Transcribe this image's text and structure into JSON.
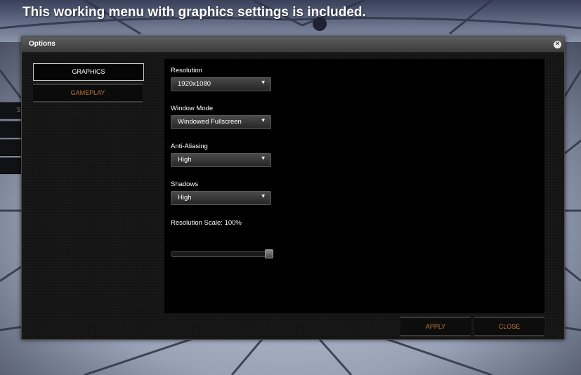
{
  "caption": "This working menu with graphics settings is included.",
  "window": {
    "title": "Options",
    "close_glyph": "✕"
  },
  "tabs": [
    {
      "label": "GRAPHICS",
      "active": true
    },
    {
      "label": "GAMEPLAY",
      "active": false
    }
  ],
  "settings": {
    "resolution": {
      "label": "Resolution",
      "value": "1920x1080"
    },
    "window_mode": {
      "label": "Window Mode",
      "value": "Windowed Fullscreen"
    },
    "anti_aliasing": {
      "label": "Anti-Aliasing",
      "value": "High"
    },
    "shadows": {
      "label": "Shadows",
      "value": "High"
    },
    "resolution_scale": {
      "label": "Resolution Scale: 100%",
      "level": 1.0
    }
  },
  "dropdown_arrow_glyph": "▼",
  "buttons": {
    "apply": "APPLY",
    "close": "CLOSE"
  },
  "background_stub_letter": "S",
  "colors": {
    "accent_orange": "#c4773a",
    "panel_black": "#000000",
    "titlebar_gray": "#4a4a4a"
  }
}
